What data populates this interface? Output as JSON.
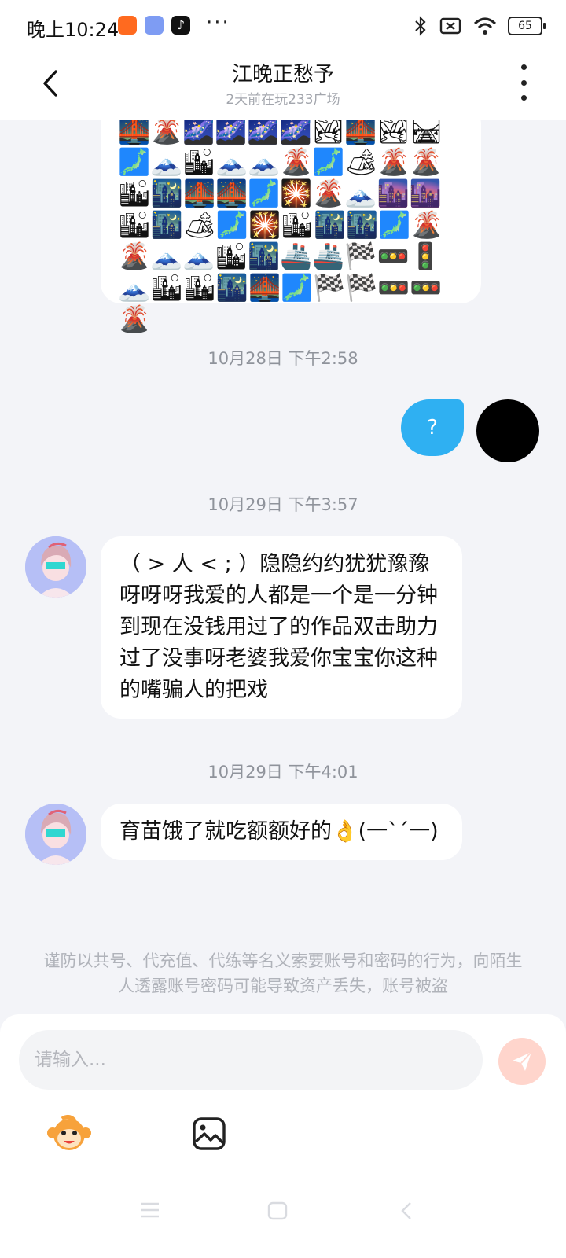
{
  "status_bar": {
    "time": "晚上10:24",
    "dots": "···",
    "battery": "65",
    "icons": [
      "mi-app-icon",
      "game-app-icon",
      "tiktok-icon",
      "bluetooth-icon",
      "no-sim-icon",
      "wifi-icon",
      "battery-icon"
    ]
  },
  "header": {
    "title": "江晚正愁予",
    "subtitle": "2天前在玩233广场"
  },
  "messages": {
    "emoji_message": "🌉🌋🌌🌌🌌🌌🏞🌉🏞🛤🗾🗻🏙🗻🗻🌋🗾🏕🌋🌋🏙🌃🌉🌉🗾🎇🌋🗻🌆🌆🏙🌃🏕🗾🎇🏙🌃🌃🗾🌋🌋🗻🗻🏙🌃🚢🚢🏁🚥🚦🗻🏙🏙🌃🌉🗾🏁🏁🚥🚥🌋",
    "ts1": "10月28日 下午2:58",
    "my_message": "?",
    "ts2": "10月29日 下午3:57",
    "msg1": "（ > 人 < ; ）隐隐约约犹犹豫豫呀呀呀我爱的人都是一个是一分钟到现在没钱用过了的作品双击助力过了没事呀老婆我爱你宝宝你这种的嘴骗人的把戏",
    "ts3": "10月29日 下午4:01",
    "msg2": "育苗饿了就吃额额好的👌(一`´一)"
  },
  "warning": "谨防以共号、代充值、代练等名义索要账号和密码的行为，向陌生人透露账号密码可能导致资产丢失，账号被盗",
  "input": {
    "placeholder": "请输入..."
  },
  "colors": {
    "bubble_out": "#2fb0f2",
    "send_button": "#ffd5cc",
    "background": "#f3f4f8"
  }
}
